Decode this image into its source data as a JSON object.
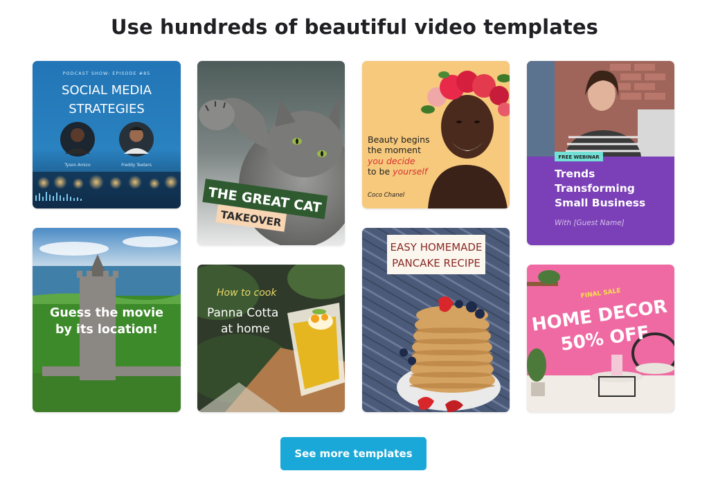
{
  "page": {
    "headline": "Use hundreds of beautiful video templates"
  },
  "templates": {
    "podcast": {
      "eyebrow": "PODCAST SHOW: EPISODE #85",
      "title_line1": "SOCIAL MEDIA",
      "title_line2": "STRATEGIES",
      "host1": "Tyson Amico",
      "host2": "Freddy Teeters"
    },
    "cat": {
      "line1": "THE GREAT CAT",
      "line2": "TAKEOVER"
    },
    "beauty": {
      "line1": "Beauty begins",
      "line2": "the moment",
      "line3": "you decide",
      "line4a": "to be ",
      "line4b": "yourself",
      "author": "Coco Chanel"
    },
    "webinar": {
      "badge": "FREE WEBINAR",
      "title_line1": "Trends",
      "title_line2": "Transforming",
      "title_line3": "Small Business",
      "guest": "With [Guest Name]"
    },
    "castle": {
      "line1": "Guess the movie",
      "line2": "by its location!"
    },
    "panna": {
      "script": "How to cook",
      "line1": "Panna Cotta",
      "line2": "at home"
    },
    "pancake": {
      "line1": "EASY HOMEMADE",
      "line2": "PANCAKE RECIPE"
    },
    "decor": {
      "eyebrow": "FINAL SALE",
      "line1": "HOME DECOR",
      "line2": "50% OFF"
    }
  },
  "cta": {
    "label": "See more templates"
  },
  "colors": {
    "cta": "#1aa8d8",
    "webinar_purple": "#7b3fb7",
    "beauty_bg": "#f6c97d",
    "decor_pink": "#ef6aa3",
    "cat_green": "#2f5a30"
  }
}
